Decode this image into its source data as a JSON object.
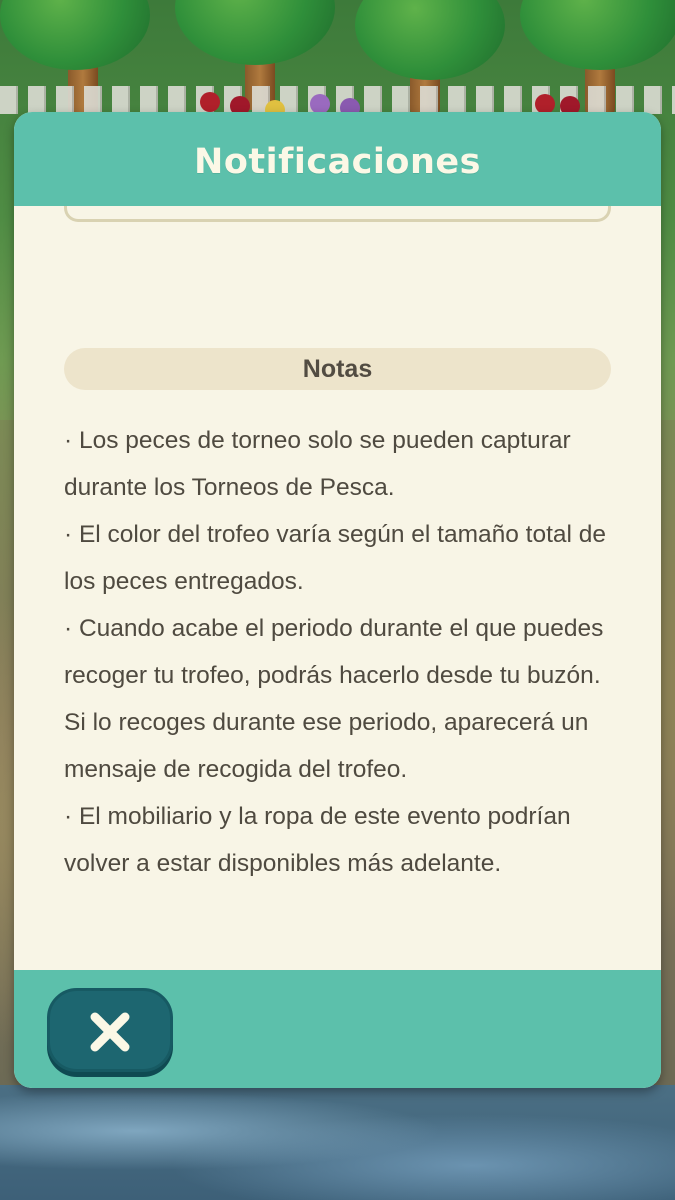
{
  "dialog": {
    "title": "Notificaciones",
    "notes_heading": "Notas",
    "notes": [
      "· Los peces de torneo solo se pueden capturar durante los Torneos de Pesca.",
      "· El color del trofeo varía según el tamaño total de los peces entregados.",
      "· Cuando acabe el periodo durante el que puedes recoger tu trofeo, podrás hacerlo desde tu buzón. Si lo recoges durante ese periodo, aparecerá un mensaje de recogida del trofeo.",
      "· El mobiliario y la ropa de este evento podrían volver a estar disponibles más adelante."
    ],
    "close_icon": "close-icon"
  },
  "colors": {
    "header_footer": "#5cc0ab",
    "panel_background": "#f8f5e6",
    "notes_bar": "#ede4cb",
    "close_button": "#1d6670",
    "title_text": "#fbf8e6",
    "body_text": "#4f4a40"
  }
}
